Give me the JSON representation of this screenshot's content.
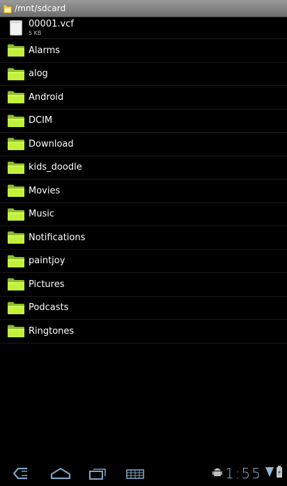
{
  "title_bar": {
    "path": "/mnt/sdcard",
    "icon": "folder-small-icon"
  },
  "file": {
    "name": "00001.vcf",
    "size": "5 KB",
    "icon": "document-icon"
  },
  "folders": [
    "Alarms",
    "alog",
    "Android",
    "DCIM",
    "Download",
    "kids_doodle",
    "Movies",
    "Music",
    "Notifications",
    "paintjoy",
    "Pictures",
    "Podcasts",
    "Ringtones"
  ],
  "folder_icon": "folder-icon",
  "nav_bar": {
    "back_icon": "back-icon",
    "home_icon": "home-icon",
    "recents_icon": "recent-apps-icon",
    "menu_icon": "menu-icon"
  },
  "status_bar": {
    "time": "1:55",
    "android_icon": "android-debug-icon",
    "signal_icon": "wifi-signal-icon",
    "battery_icon": "battery-icon",
    "accent": "#8fb6d8"
  }
}
